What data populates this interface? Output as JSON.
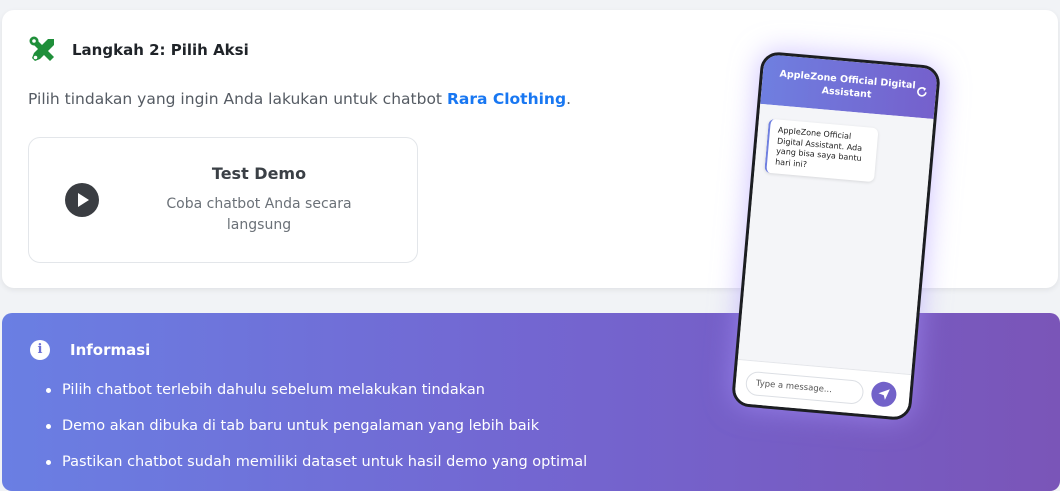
{
  "step": {
    "title": "Langkah 2: Pilih Aksi",
    "description_prefix": "Pilih tindakan yang ingin Anda lakukan untuk chatbot ",
    "bot_name": "Rara Clothing",
    "description_suffix": ".",
    "demo_card": {
      "title": "Test Demo",
      "subtitle": "Coba chatbot Anda secara langsung",
      "icon": "play-icon"
    },
    "icon": "tools-icon"
  },
  "info": {
    "title": "Informasi",
    "icon": "info-icon",
    "items": [
      "Pilih chatbot terlebih dahulu sebelum melakukan tindakan",
      "Demo akan dibuka di tab baru untuk pengalaman yang lebih baik",
      "Pastikan chatbot sudah memiliki dataset untuk hasil demo yang optimal"
    ]
  },
  "phone": {
    "header_title": "AppleZone Official Digital Assistant",
    "message": "AppleZone Official Digital Assistant. Ada yang bisa saya bantu hari ini?",
    "input_placeholder": "Type a message..."
  },
  "colors": {
    "accent_link": "#1877f2",
    "tools_icon": "#1f8f3a",
    "gradient_start": "#6a7fe3",
    "gradient_end": "#7a55b8"
  }
}
